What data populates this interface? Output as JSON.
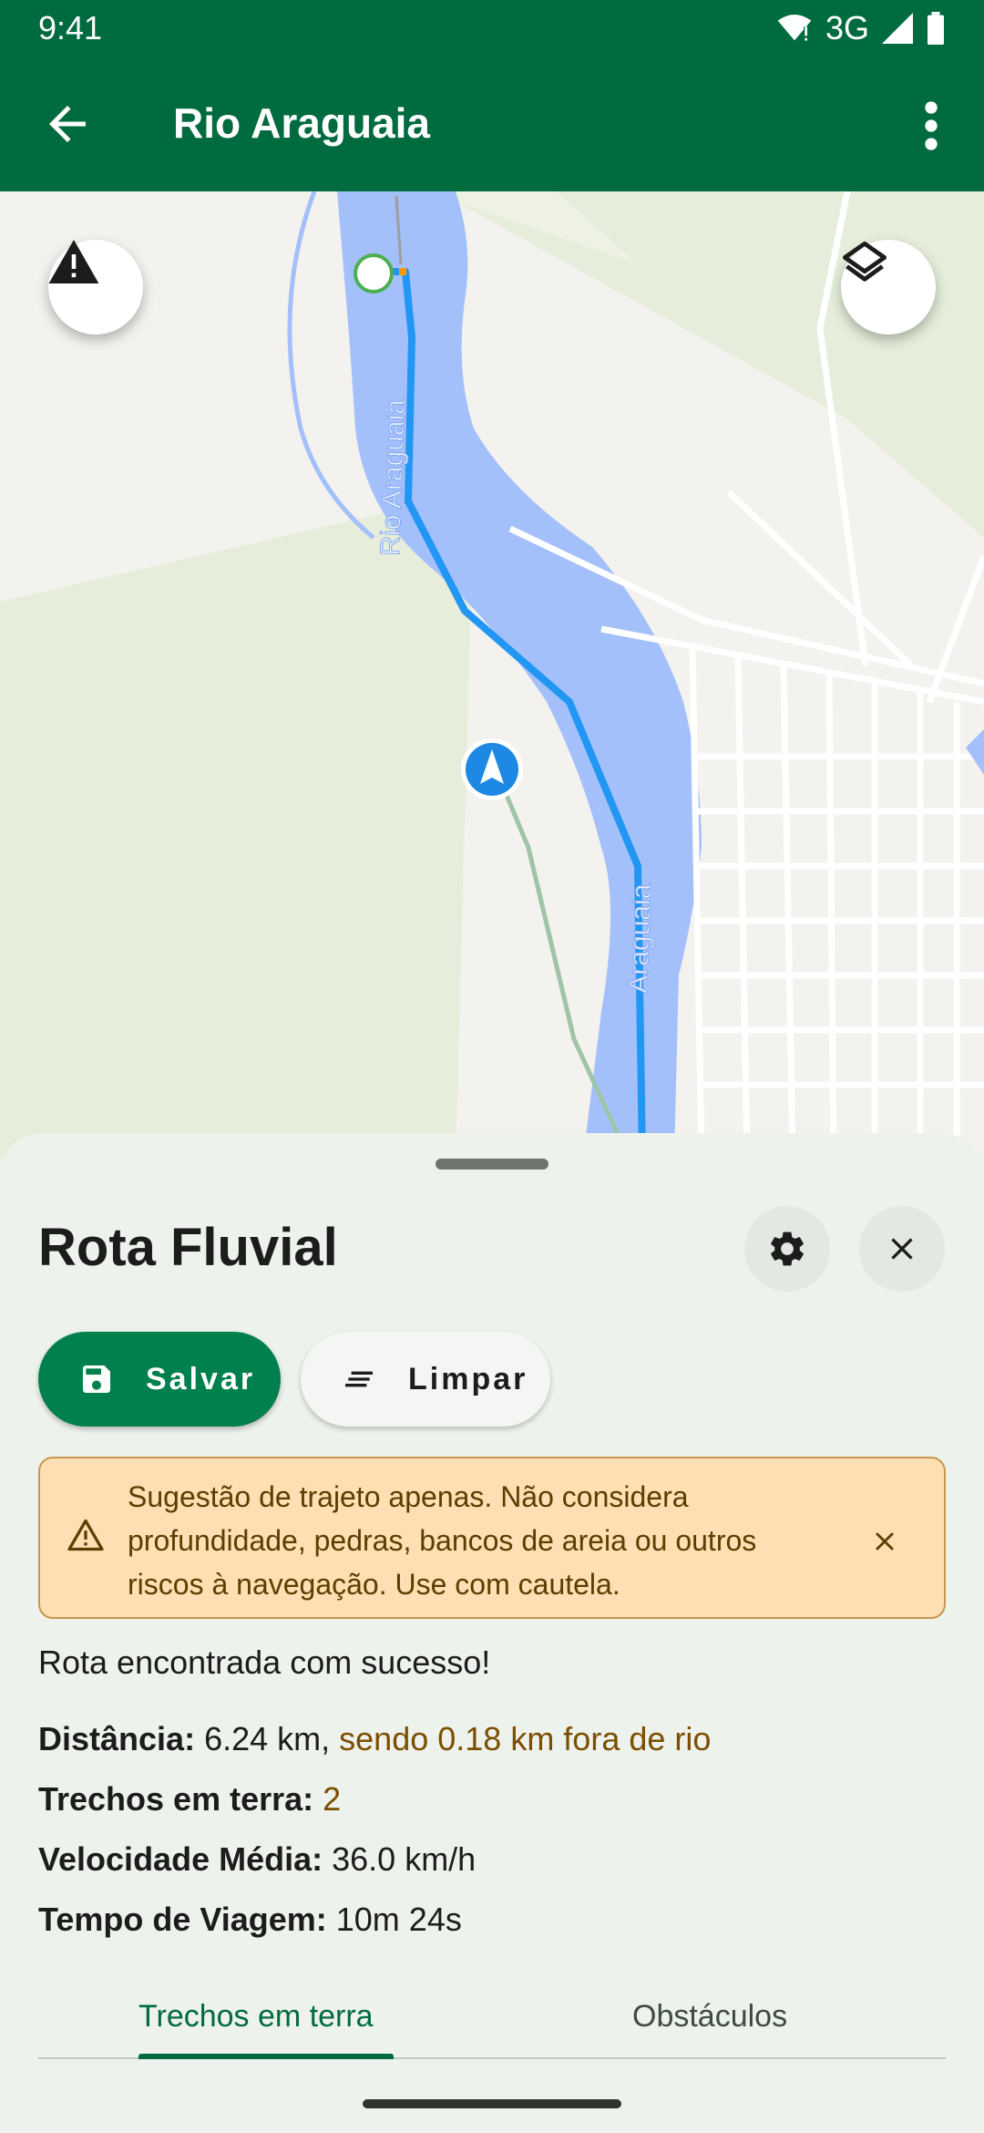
{
  "status_bar": {
    "time": "9:41",
    "network": "3G"
  },
  "app_bar": {
    "title": "Rio Araguaia",
    "back_icon": "arrow-back-icon",
    "more_icon": "more-vert-icon"
  },
  "map": {
    "river_label_top": "Rio Araguaia",
    "river_label_bottom": "Araguaia",
    "warning_fab_icon": "warning-icon",
    "layers_fab_icon": "layers-icon",
    "colors": {
      "water": "#a4c0fb",
      "route": "#2196f3",
      "park": "#e6eedb",
      "land": "#f4f2ee"
    }
  },
  "sheet": {
    "title": "Rota Fluvial",
    "settings_icon": "gear-icon",
    "close_icon": "close-icon",
    "save_label": "Salvar",
    "clear_label": "Limpar",
    "alert_text": "Sugestão de trajeto apenas. Não considera profundidade, pedras, bancos de areia ou outros riscos à navegação. Use com cautela.",
    "success_text": "Rota encontrada com sucesso!",
    "distance_label": "Distância:",
    "distance_value": "6.24 km,",
    "distance_offriver": "sendo 0.18 km fora de rio",
    "land_segments_label": "Trechos em terra:",
    "land_segments_value": "2",
    "speed_label": "Velocidade Média:",
    "speed_value": "36.0 km/h",
    "time_label": "Tempo de Viagem:",
    "time_value": "10m 24s",
    "tabs": [
      {
        "label": "Trechos em terra",
        "selected": true
      },
      {
        "label": "Obstáculos",
        "selected": false
      }
    ]
  }
}
